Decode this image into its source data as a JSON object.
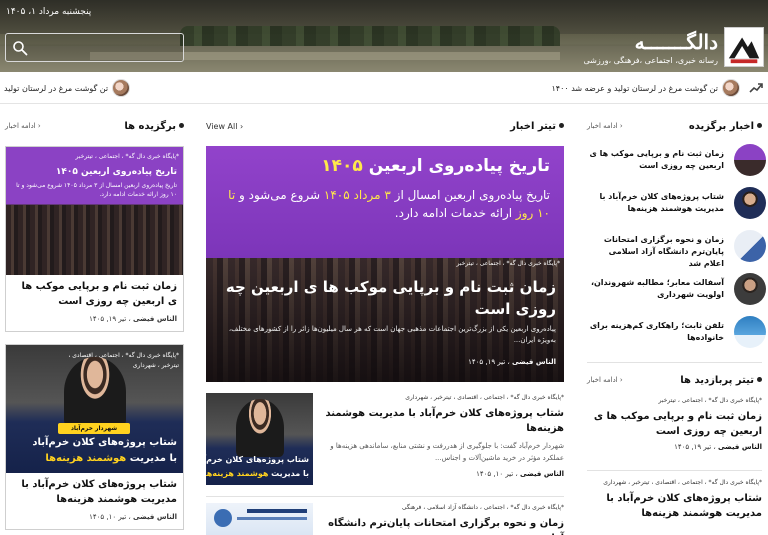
{
  "header": {
    "date": "پنجشنبه مرداد ۱، ۱۴۰۵",
    "site_name": "دالگـــــــه",
    "tagline": "رسانه خبری، اجتماعی ،فرهنگی ،ورزشی",
    "search_placeholder": ""
  },
  "ticker": {
    "items": [
      "تن گوشت مرغ در لرستان تولید و عرضه شد ۱۴۰۰",
      "تن گوشت مرغ در لرستان تولید"
    ]
  },
  "latest": {
    "title": "اخبار برگزیده",
    "more": "ادامه اخبار",
    "items": [
      "زمان ثبت نام و برپایی موکب ها ی اربعین چه روزی است",
      "شتاب پروژه‌های کلان خرم‌آباد با مدیریت هوشمند هزینه‌ها",
      "زمان و نحوه برگزاری امتحانات پایان‌ترم دانشگاه آزاد اسلامی اعلام شد",
      "آسفالت معابر؛ مطالبه شهروندان، اولویت شهرداری",
      "تلفن ثابت؛ راهکاری کم‌هزینه برای خانواده‌ها"
    ]
  },
  "chosen": {
    "title": "تیتر پربازدید ها",
    "more": "ادامه اخبار",
    "items": [
      {
        "cats": "*پایگاه خبری دال گه* ، اجتماعی ، تیترخبر",
        "title": "زمان ثبت نام و برپایی موکب ها ی اربعین چه روزی است",
        "author": "الناس فیضی",
        "date": "تیر ۱۹, ۱۴۰۵"
      },
      {
        "cats": "*پایگاه خبری دال گه* ، اجتماعی ، اقتصادی ، تیترخبر ، شهرداری",
        "title": "شتاب پروژه‌های کلان خرم‌آباد با مدیریت هوشمند هزینه‌ها",
        "author": "",
        "date": ""
      }
    ]
  },
  "headlines": {
    "title": "تیتر اخبار",
    "more": "View All",
    "hero": {
      "img_title_a": "تاریخ پیاده‌روی اربعین ",
      "img_title_b": "۱۴۰۵",
      "img_sub_a": "تاریخ پیاده‌روی اربعین امسال از ",
      "img_sub_b": "۳ مرداد ۱۴۰۵",
      "img_sub_c": " شروع می‌شود و ",
      "img_sub_d": "تا ۱۰ روز",
      "img_sub_e": " ارائه خدمات ادامه دارد.",
      "cats": "*پایگاه خبری دال گه* ، اجتماعی ، تیترخبر",
      "title": "زمان ثبت نام و برپایی موکب ها ی اربعین چه روزی است",
      "excerpt": "پیاده‌روی اربعین یکی از بزرگ‌ترین اجتماعات مذهبی جهان است که هر سال میلیون‌ها زائر را از کشورهای مختلف، به‌ویژه ایران...",
      "author": "الناس فیضی",
      "date": "تیر ۱۹, ۱۴۰۵"
    },
    "items": [
      {
        "cats": "*پایگاه خبری دال گه* ، اجتماعی ، اقتصادی ، تیترخبر ، شهرداری",
        "title": "شتاب پروژه‌های کلان خرم‌آباد با مدیریت هوشمند هزینه‌ها",
        "excerpt": "شهردار خرم‌آباد گفت: با جلوگیری از هدررفت و نشتی منابع، ساماندهی هزینه‌ها و عملکرد مؤثر در خرید ماشین‌آلات و اجناس...",
        "author": "الناس فیضی",
        "date": "تیر ۱۰, ۱۴۰۵"
      },
      {
        "cats": "*پایگاه خبری دال گه* ، اجتماعی ، دانشگاه آزاد اسلامی ، فرهنگی",
        "title": "زمان و نحوه برگزاری امتحانات پایان‌ترم دانشگاه آزاد",
        "excerpt": "",
        "author": "",
        "date": ""
      }
    ]
  },
  "featured": {
    "title": "برگزیده ها",
    "more": "ادامه اخبار",
    "items": [
      {
        "cats": "*پایگاه خبری دال گه* ، اجتماعی ، تیترخبر",
        "img_title": "تاریخ پیاده‌روی اربعین ۱۴۰۵",
        "img_sub": "تاریخ پیاده‌روی اربعین امسال از ۳ مرداد ۱۴۰۵ شروع می‌شود و تا ۱۰ روز ارائه خدمات ادامه دارد.",
        "title": "زمان ثبت نام و برپایی موکب ها ی اربعین چه روزی است",
        "author": "الناس فیضی",
        "date": "تیر ۱۹, ۱۴۰۵"
      },
      {
        "cats": "*پایگاه خبری دال گه* ، اجتماعی ، اقتصادی ، تیترخبر ، شهرداری",
        "img_title_a": "شتاب پروژه‌های کلان خرم‌آباد",
        "img_title_b": "با مدیریت ",
        "img_title_c": "هوشمند هزینه‌ها",
        "img_badge": "شهردار خرم‌آباد",
        "title": "شتاب پروژه‌های کلان خرم‌آباد با مدیریت هوشمند هزینه‌ها",
        "author": "الناس فیضی",
        "date": "تیر ۱۰, ۱۴۰۵"
      }
    ]
  },
  "colors": {
    "purple": "#8e44c7",
    "yellow": "#ffe94a",
    "navy": "#15224a"
  }
}
